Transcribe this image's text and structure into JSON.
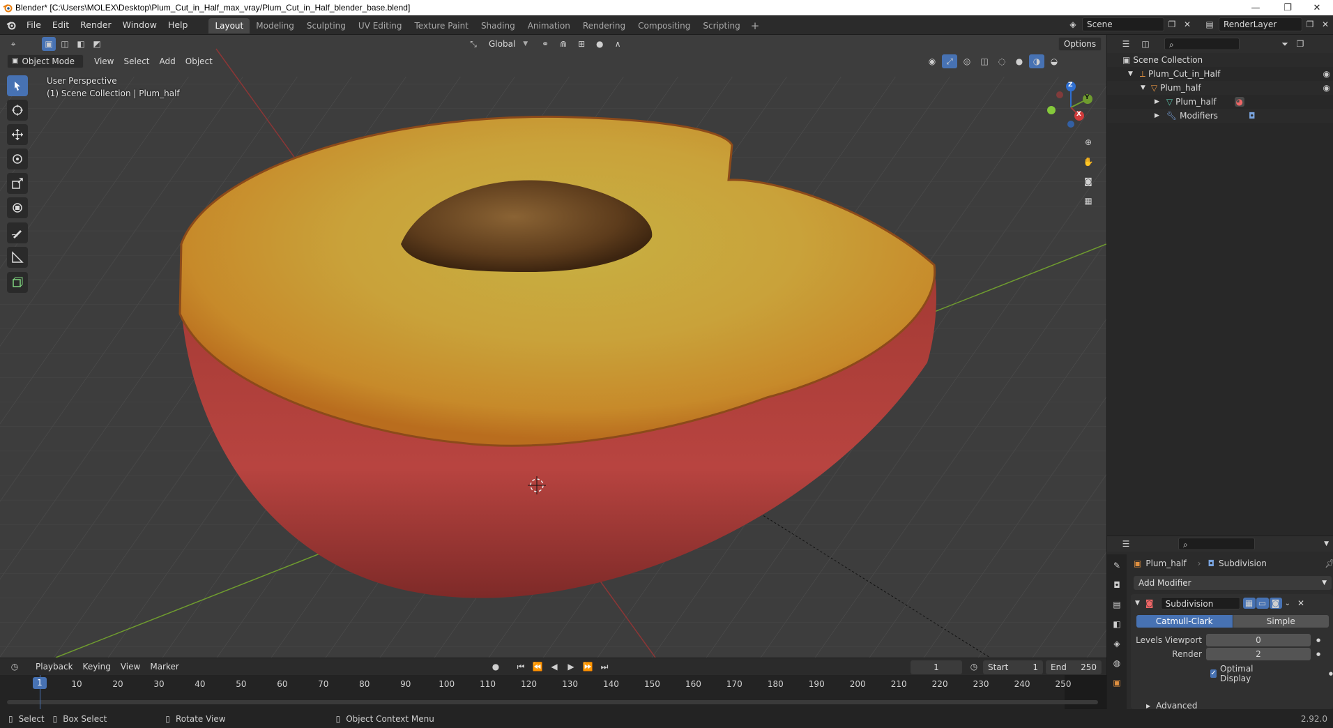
{
  "window": {
    "title": "Blender* [C:\\Users\\MOLEX\\Desktop\\Plum_Cut_in_Half_max_vray/Plum_Cut_in_Half_blender_base.blend]",
    "minimize": "—",
    "restore": "❐",
    "close": "✕"
  },
  "menu": [
    "File",
    "Edit",
    "Render",
    "Window",
    "Help"
  ],
  "workspaces": [
    "Layout",
    "Modeling",
    "Sculpting",
    "UV Editing",
    "Texture Paint",
    "Shading",
    "Animation",
    "Rendering",
    "Compositing",
    "Scripting"
  ],
  "scene": {
    "label": "Scene",
    "render_layer": "RenderLayer"
  },
  "viewport": {
    "transform_orientation": "Global",
    "options_label": "Options",
    "mode": "Object Mode",
    "menus": [
      "View",
      "Select",
      "Add",
      "Object"
    ],
    "perspective_label": "User Perspective",
    "collection_label": "(1) Scene Collection | Plum_half",
    "gizmo": {
      "x": "X",
      "y": "Y",
      "z": "Z"
    }
  },
  "outliner": {
    "root": "Scene Collection",
    "items": [
      {
        "label": "Plum_Cut_in_Half",
        "depth": 1
      },
      {
        "label": "Plum_half",
        "depth": 2
      },
      {
        "label": "Plum_half",
        "depth": 3
      },
      {
        "label": "Modifiers",
        "depth": 3
      }
    ]
  },
  "properties": {
    "object_name": "Plum_half",
    "modifier_tab": "Subdivision",
    "add_modifier": "Add Modifier",
    "modifier_name": "Subdivision",
    "type_options": [
      "Catmull-Clark",
      "Simple"
    ],
    "selected_type": "Catmull-Clark",
    "levels_viewport_label": "Levels Viewport",
    "levels_viewport": "0",
    "render_label": "Render",
    "render_value": "2",
    "optimal_display": "Optimal Display",
    "advanced": "Advanced"
  },
  "timeline": {
    "menus": [
      "Playback",
      "Keying",
      "View",
      "Marker"
    ],
    "current_frame": "1",
    "start_label": "Start",
    "start": "1",
    "end_label": "End",
    "end": "250",
    "ticks": [
      "1",
      "10",
      "20",
      "30",
      "40",
      "50",
      "60",
      "70",
      "80",
      "90",
      "100",
      "110",
      "120",
      "130",
      "140",
      "150",
      "160",
      "170",
      "180",
      "190",
      "200",
      "210",
      "220",
      "230",
      "240",
      "250"
    ]
  },
  "status": {
    "select": "Select",
    "box_select": "Box Select",
    "rotate_view": "Rotate View",
    "context_menu": "Object Context Menu",
    "version": "2.92.0"
  },
  "colors": {
    "accent": "#4772b3",
    "x_axis": "#9e3a3a",
    "y_axis": "#6f9c2f",
    "z_axis": "#2f6fd0"
  }
}
